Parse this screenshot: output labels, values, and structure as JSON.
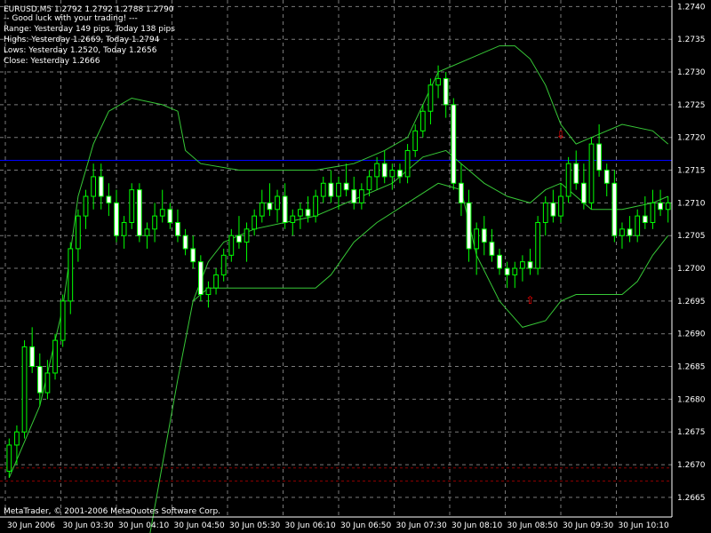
{
  "symbol_line": "EURUSD,M5  1.2792 1.2792 1.2788 1.2790",
  "info_lines": [
    "-- Good luck with your trading! ---",
    "Range: Yesterday 149 pips, Today 138 pips",
    "Highs: Yesterday 1.2669, Today 1.2794",
    "Lows: Yesterday 1.2520, Today 1.2656",
    "Close: Yesterday 1.2666"
  ],
  "copyright": "MetaTrader, © 2001-2006 MetaQuotes Software Corp.",
  "colors": {
    "background": "#000000",
    "grid": "#7a7a7a",
    "candle": "#00ff00",
    "band": "#37c837",
    "level_line": "#0000ff",
    "range_line": "#8b0000",
    "signal": "#ff0000",
    "text": "#ffffff"
  },
  "chart_data": {
    "type": "candlestick",
    "symbol": "EURUSD",
    "timeframe": "M5",
    "ylim": [
      1.2662,
      1.2741
    ],
    "y_ticks": [
      "1.2740",
      "1.2735",
      "1.2730",
      "1.2725",
      "1.2720",
      "1.2715",
      "1.2710",
      "1.2705",
      "1.2700",
      "1.2695",
      "1.2690",
      "1.2685",
      "1.2680",
      "1.2675",
      "1.2670",
      "1.2665"
    ],
    "x_tick_labels": [
      "30 Jun 2006",
      "30 Jun 03:30",
      "30 Jun 04:10",
      "30 Jun 04:50",
      "30 Jun 05:30",
      "30 Jun 06:10",
      "30 Jun 06:50",
      "30 Jun 07:30",
      "30 Jun 08:10",
      "30 Jun 08:50",
      "30 Jun 09:30",
      "30 Jun 10:10"
    ],
    "grid": true,
    "horizontal_level": 1.27165,
    "range_lines": [
      1.26695,
      1.26675
    ],
    "ohlc": [
      [
        1.2669,
        1.2674,
        1.2668,
        1.2673
      ],
      [
        1.2673,
        1.2676,
        1.267,
        1.2675
      ],
      [
        1.2675,
        1.2689,
        1.2674,
        1.2688
      ],
      [
        1.2688,
        1.2691,
        1.2684,
        1.2685
      ],
      [
        1.2685,
        1.2687,
        1.2679,
        1.2681
      ],
      [
        1.2681,
        1.2686,
        1.268,
        1.2684
      ],
      [
        1.2684,
        1.269,
        1.2683,
        1.2689
      ],
      [
        1.2689,
        1.2696,
        1.2688,
        1.2695
      ],
      [
        1.2695,
        1.2704,
        1.2693,
        1.2703
      ],
      [
        1.2703,
        1.2709,
        1.2701,
        1.2708
      ],
      [
        1.2708,
        1.2712,
        1.2706,
        1.2711
      ],
      [
        1.2711,
        1.2716,
        1.2709,
        1.2714
      ],
      [
        1.2714,
        1.2716,
        1.2709,
        1.2711
      ],
      [
        1.2711,
        1.2713,
        1.2708,
        1.271
      ],
      [
        1.271,
        1.2712,
        1.2704,
        1.2705
      ],
      [
        1.2705,
        1.2708,
        1.2703,
        1.2707
      ],
      [
        1.2707,
        1.2713,
        1.2706,
        1.2712
      ],
      [
        1.2712,
        1.2713,
        1.2704,
        1.2705
      ],
      [
        1.2705,
        1.2707,
        1.2703,
        1.2706
      ],
      [
        1.2706,
        1.271,
        1.2704,
        1.2708
      ],
      [
        1.2708,
        1.2712,
        1.2707,
        1.2709
      ],
      [
        1.2709,
        1.271,
        1.2706,
        1.2707
      ],
      [
        1.2707,
        1.2709,
        1.2704,
        1.2705
      ],
      [
        1.2705,
        1.2706,
        1.2702,
        1.2703
      ],
      [
        1.2703,
        1.2705,
        1.27,
        1.2701
      ],
      [
        1.2701,
        1.2702,
        1.2695,
        1.2696
      ],
      [
        1.2696,
        1.2698,
        1.2694,
        1.2697
      ],
      [
        1.2697,
        1.27,
        1.2696,
        1.2699
      ],
      [
        1.2699,
        1.2703,
        1.2698,
        1.2702
      ],
      [
        1.2702,
        1.2706,
        1.2701,
        1.2705
      ],
      [
        1.2705,
        1.2708,
        1.2703,
        1.2704
      ],
      [
        1.2704,
        1.2707,
        1.2701,
        1.2706
      ],
      [
        1.2706,
        1.2709,
        1.2705,
        1.2708
      ],
      [
        1.2708,
        1.2712,
        1.2707,
        1.271
      ],
      [
        1.271,
        1.2713,
        1.2708,
        1.2709
      ],
      [
        1.2709,
        1.2712,
        1.2707,
        1.2711
      ],
      [
        1.2711,
        1.2713,
        1.2706,
        1.2707
      ],
      [
        1.2707,
        1.2709,
        1.2705,
        1.2708
      ],
      [
        1.2708,
        1.271,
        1.2706,
        1.2709
      ],
      [
        1.2709,
        1.2711,
        1.2707,
        1.2708
      ],
      [
        1.2708,
        1.2712,
        1.2707,
        1.2711
      ],
      [
        1.2711,
        1.2714,
        1.271,
        1.2713
      ],
      [
        1.2713,
        1.2715,
        1.271,
        1.2711
      ],
      [
        1.2711,
        1.2714,
        1.2709,
        1.2713
      ],
      [
        1.2713,
        1.2716,
        1.2711,
        1.2712
      ],
      [
        1.2712,
        1.2714,
        1.2709,
        1.271
      ],
      [
        1.271,
        1.2713,
        1.2709,
        1.2712
      ],
      [
        1.2712,
        1.2715,
        1.2711,
        1.2714
      ],
      [
        1.2714,
        1.2717,
        1.2712,
        1.2716
      ],
      [
        1.2716,
        1.2718,
        1.2713,
        1.2714
      ],
      [
        1.2714,
        1.2716,
        1.2712,
        1.2715
      ],
      [
        1.2715,
        1.2716,
        1.2713,
        1.2714
      ],
      [
        1.2714,
        1.2719,
        1.2713,
        1.2718
      ],
      [
        1.2718,
        1.2722,
        1.2717,
        1.2721
      ],
      [
        1.2721,
        1.2725,
        1.272,
        1.2724
      ],
      [
        1.2724,
        1.2729,
        1.2722,
        1.2728
      ],
      [
        1.2728,
        1.2731,
        1.2726,
        1.2729
      ],
      [
        1.2729,
        1.273,
        1.2723,
        1.2725
      ],
      [
        1.2725,
        1.2726,
        1.2712,
        1.2713
      ],
      [
        1.2713,
        1.2716,
        1.2708,
        1.271
      ],
      [
        1.271,
        1.2712,
        1.2701,
        1.2703
      ],
      [
        1.2703,
        1.2707,
        1.2699,
        1.2706
      ],
      [
        1.2706,
        1.2708,
        1.2702,
        1.2704
      ],
      [
        1.2704,
        1.2706,
        1.2701,
        1.2702
      ],
      [
        1.2702,
        1.2703,
        1.2699,
        1.27
      ],
      [
        1.27,
        1.2701,
        1.2697,
        1.2699
      ],
      [
        1.2699,
        1.2701,
        1.2697,
        1.27
      ],
      [
        1.27,
        1.2702,
        1.2698,
        1.2701
      ],
      [
        1.2701,
        1.2703,
        1.2699,
        1.27
      ],
      [
        1.27,
        1.2708,
        1.2699,
        1.2707
      ],
      [
        1.2707,
        1.2711,
        1.2705,
        1.271
      ],
      [
        1.271,
        1.2712,
        1.2707,
        1.2708
      ],
      [
        1.2708,
        1.2713,
        1.2707,
        1.2711
      ],
      [
        1.2711,
        1.2717,
        1.271,
        1.2716
      ],
      [
        1.2716,
        1.2718,
        1.2712,
        1.2713
      ],
      [
        1.2713,
        1.2716,
        1.2709,
        1.271
      ],
      [
        1.271,
        1.272,
        1.2709,
        1.2719
      ],
      [
        1.2719,
        1.2722,
        1.2714,
        1.2715
      ],
      [
        1.2715,
        1.2716,
        1.2711,
        1.2713
      ],
      [
        1.2713,
        1.2715,
        1.2704,
        1.2705
      ],
      [
        1.2705,
        1.2707,
        1.2703,
        1.2706
      ],
      [
        1.2706,
        1.2708,
        1.2704,
        1.2705
      ],
      [
        1.2705,
        1.2709,
        1.2704,
        1.2708
      ],
      [
        1.2708,
        1.2711,
        1.2706,
        1.2707
      ],
      [
        1.2707,
        1.2712,
        1.2706,
        1.271
      ],
      [
        1.271,
        1.2712,
        1.2708,
        1.2709
      ],
      [
        1.2709,
        1.2711,
        1.2707,
        1.271
      ]
    ],
    "bands": {
      "upper": [
        [
          0,
          1.2668
        ],
        [
          4,
          1.2679
        ],
        [
          7,
          1.2694
        ],
        [
          9,
          1.2711
        ],
        [
          11,
          1.2719
        ],
        [
          13,
          1.2724
        ],
        [
          16,
          1.2726
        ],
        [
          20,
          1.2725
        ],
        [
          22,
          1.2724
        ],
        [
          23,
          1.2718
        ],
        [
          25,
          1.2716
        ],
        [
          30,
          1.2715
        ],
        [
          40,
          1.2715
        ],
        [
          45,
          1.2716
        ],
        [
          49,
          1.2718
        ],
        [
          52,
          1.272
        ],
        [
          54,
          1.2725
        ],
        [
          56,
          1.273
        ],
        [
          60,
          1.2732
        ],
        [
          64,
          1.2734
        ],
        [
          66,
          1.2734
        ],
        [
          68,
          1.2732
        ],
        [
          70,
          1.2728
        ],
        [
          72,
          1.2722
        ],
        [
          74,
          1.2719
        ],
        [
          76,
          1.272
        ],
        [
          80,
          1.2722
        ],
        [
          84,
          1.2721
        ],
        [
          86,
          1.2719
        ]
      ],
      "middle": [
        [
          18,
          1.2657
        ],
        [
          20,
          1.267
        ],
        [
          22,
          1.2683
        ],
        [
          24,
          1.2695
        ],
        [
          26,
          1.2701
        ],
        [
          28,
          1.2704
        ],
        [
          32,
          1.2706
        ],
        [
          40,
          1.2708
        ],
        [
          46,
          1.2711
        ],
        [
          50,
          1.2713
        ],
        [
          54,
          1.2717
        ],
        [
          57,
          1.2718
        ],
        [
          59,
          1.2716
        ],
        [
          62,
          1.2713
        ],
        [
          65,
          1.2711
        ],
        [
          68,
          1.271
        ],
        [
          70,
          1.2712
        ],
        [
          72,
          1.2713
        ],
        [
          74,
          1.2711
        ],
        [
          76,
          1.2709
        ],
        [
          80,
          1.2709
        ],
        [
          84,
          1.271
        ],
        [
          86,
          1.2711
        ]
      ],
      "lower": [
        [
          24,
          1.2695
        ],
        [
          26,
          1.2697
        ],
        [
          28,
          1.2697
        ],
        [
          34,
          1.2697
        ],
        [
          40,
          1.2697
        ],
        [
          42,
          1.2699
        ],
        [
          45,
          1.2704
        ],
        [
          48,
          1.2707
        ],
        [
          52,
          1.271
        ],
        [
          56,
          1.2713
        ],
        [
          59,
          1.2712
        ],
        [
          61,
          1.2702
        ],
        [
          64,
          1.2695
        ],
        [
          67,
          1.2691
        ],
        [
          70,
          1.2692
        ],
        [
          72,
          1.2695
        ],
        [
          74,
          1.2696
        ],
        [
          77,
          1.2696
        ],
        [
          80,
          1.2696
        ],
        [
          82,
          1.2698
        ],
        [
          84,
          1.2702
        ],
        [
          86,
          1.2705
        ]
      ]
    },
    "signals": [
      {
        "index": 72,
        "direction": "down",
        "price": 1.2719
      },
      {
        "index": 68,
        "direction": "up",
        "price": 1.2697
      }
    ]
  }
}
